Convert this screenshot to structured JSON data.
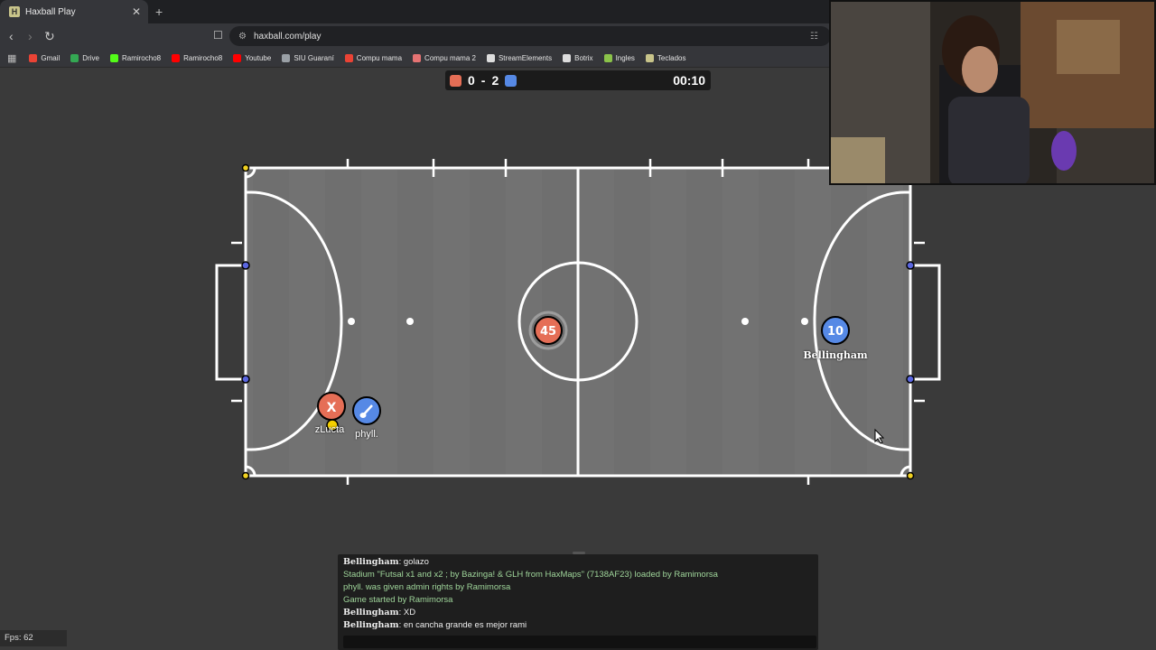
{
  "browser": {
    "tab_title": "Haxball Play",
    "tab_favicon": "H",
    "close_glyph": "✕",
    "newtab_glyph": "+",
    "url": "haxball.com/play",
    "bookmarks": [
      {
        "label": "Gmail",
        "color": "#ea4335"
      },
      {
        "label": "Drive",
        "color": "#34a853"
      },
      {
        "label": "Ramirocho8",
        "color": "#53fc18"
      },
      {
        "label": "Ramirocho8",
        "color": "#ff0000"
      },
      {
        "label": "Youtube",
        "color": "#ff0000"
      },
      {
        "label": "SIU Guaraní",
        "color": "#9aa0a6"
      },
      {
        "label": "Compu mama",
        "color": "#ea4335"
      },
      {
        "label": "Compu mama 2",
        "color": "#e57373"
      },
      {
        "label": "StreamElements",
        "color": "#dddddd"
      },
      {
        "label": "Botrix",
        "color": "#dddddd"
      },
      {
        "label": "Ingles",
        "color": "#8bc34a"
      },
      {
        "label": "Teclados",
        "color": "#c8c48a"
      }
    ]
  },
  "scoreboard": {
    "red_score": "0",
    "separator": "-",
    "blue_score": "2",
    "time": "00:10",
    "red_color": "#e56e56",
    "blue_color": "#5689e5"
  },
  "players": [
    {
      "name": "zLucta",
      "avatar": "X",
      "team": "red"
    },
    {
      "name": "phyll.",
      "avatar": "guitar-icon",
      "team": "blue"
    },
    {
      "name": "Bellingham",
      "avatar": "10",
      "team": "blue"
    },
    {
      "name": "",
      "avatar": "45",
      "team": "red"
    }
  ],
  "chat": {
    "lines": [
      {
        "author": "Bellingham",
        "text": "golazo"
      },
      {
        "system": "Stadium \"Futsal x1 and x2 ; by Bazinga! & GLH from HaxMaps\" (7138AF23) loaded by Ramimorsa"
      },
      {
        "system": "phyll. was given admin rights by Ramimorsa"
      },
      {
        "system": "Game started by Ramimorsa"
      },
      {
        "author": "Bellingham",
        "text": "XD"
      },
      {
        "author": "Bellingham",
        "text": "en cancha grande es mejor rami"
      }
    ],
    "input_placeholder": ""
  },
  "fps": "Fps: 62"
}
